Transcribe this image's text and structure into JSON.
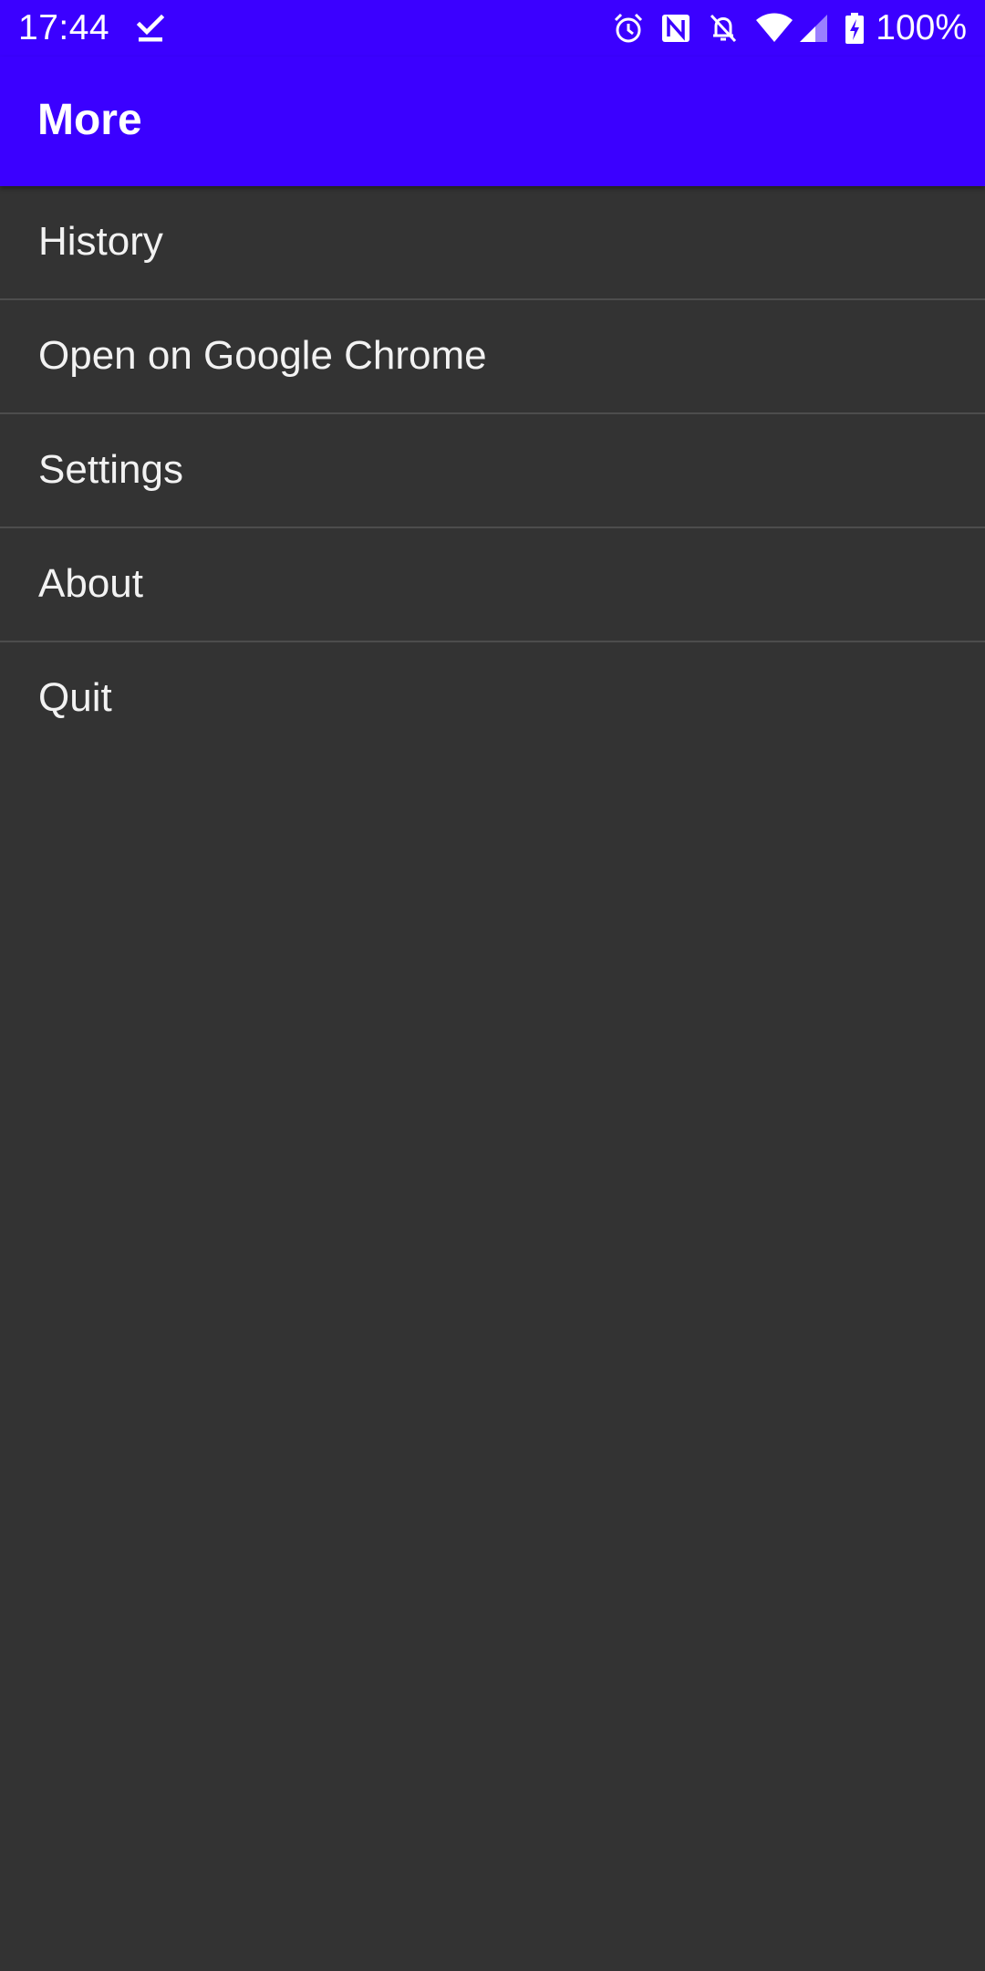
{
  "status_bar": {
    "time": "17:44",
    "battery": "100%",
    "background": "#3b00ff",
    "icons": [
      "download-done-icon",
      "alarm-icon",
      "nfc-icon",
      "notifications-off-icon",
      "wifi-icon",
      "signal-icon",
      "battery-charging-icon"
    ]
  },
  "app_bar": {
    "title": "More",
    "background": "#3b00ff"
  },
  "menu": {
    "background": "#333333",
    "items": [
      {
        "label": "History"
      },
      {
        "label": "Open on Google Chrome"
      },
      {
        "label": "Settings"
      },
      {
        "label": "About"
      },
      {
        "label": "Quit"
      }
    ]
  }
}
